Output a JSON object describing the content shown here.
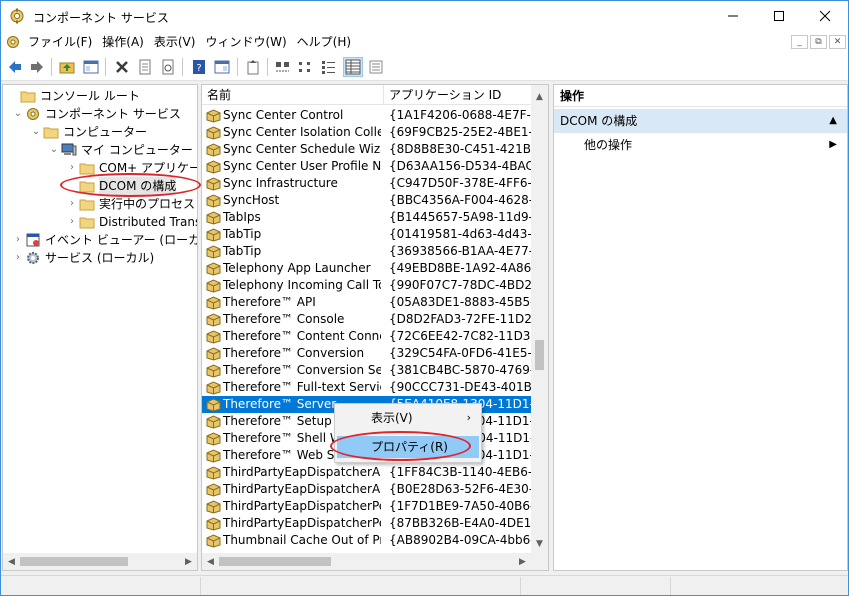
{
  "window": {
    "title": "コンポーネント サービス",
    "controls": {
      "minimize": "—",
      "maximize": "☐",
      "close": "✕"
    }
  },
  "menubar": {
    "items": [
      "ファイル(F)",
      "操作(A)",
      "表示(V)",
      "ウィンドウ(W)",
      "ヘルプ(H)"
    ],
    "mdi_minimize": "_",
    "mdi_restore": "⧉",
    "mdi_close": "✕"
  },
  "toolbar": {
    "icons": [
      "back-icon",
      "forward-icon",
      "up-folder-icon",
      "show-tree-icon",
      "delete-icon",
      "properties-icon",
      "refresh-icon",
      "help-icon",
      "action-pane-icon",
      "export-icon",
      "large-icons-icon",
      "small-icons-icon",
      "list-view-icon",
      "detail-view-icon",
      "tile-icon"
    ]
  },
  "tree": {
    "items": [
      {
        "label": "コンソール ルート",
        "expander": "",
        "icon": "folder-icon",
        "depth": 0
      },
      {
        "label": "コンポーネント サービス",
        "expander": "v",
        "icon": "component-services-icon",
        "depth": 1
      },
      {
        "label": "コンピューター",
        "expander": "v",
        "icon": "folder-icon",
        "depth": 2
      },
      {
        "label": "マイ コンピューター",
        "expander": "v",
        "icon": "computer-icon",
        "depth": 3
      },
      {
        "label": "COM+ アプリケーシ",
        "expander": ">",
        "icon": "folder-icon",
        "depth": 4
      },
      {
        "label": "DCOM の構成",
        "expander": "",
        "icon": "folder-icon",
        "depth": 4
      },
      {
        "label": "実行中のプロセス",
        "expander": ">",
        "icon": "folder-icon",
        "depth": 4
      },
      {
        "label": "Distributed Transa",
        "expander": ">",
        "icon": "folder-icon",
        "depth": 4
      },
      {
        "label": "イベント ビューアー (ローカル)",
        "expander": ">",
        "icon": "event-viewer-icon",
        "depth": 1
      },
      {
        "label": "サービス (ローカル)",
        "expander": ">",
        "icon": "services-gear-icon",
        "depth": 1
      }
    ],
    "selected_index": 5
  },
  "list": {
    "columns": [
      "名前",
      "アプリケーション ID"
    ],
    "rows": [
      {
        "name": "Sync Center Control",
        "id": "{1A1F4206-0688-4E7F-BE03"
      },
      {
        "name": "Sync Center Isolation Collect...",
        "id": "{69F9CB25-25E2-4BE1-AB8I"
      },
      {
        "name": "Sync Center Schedule Wizard",
        "id": "{8D8B8E30-C451-421B-855:"
      },
      {
        "name": "Sync Center User Profile Not...",
        "id": "{D63AA156-D534-4BAC-9B"
      },
      {
        "name": "Sync Infrastructure",
        "id": "{C947D50F-378E-4FF6-8835"
      },
      {
        "name": "SyncHost",
        "id": "{BBC4356A-F004-4628-A27."
      },
      {
        "name": "TabIps",
        "id": "{B1445657-5A98-11d9-A4E5"
      },
      {
        "name": "TabTip",
        "id": "{01419581-4d63-4d43-ac26"
      },
      {
        "name": "TabTip",
        "id": "{36938566-B1AA-4E77-9B3("
      },
      {
        "name": "Telephony App Launcher",
        "id": "{49EBD8BE-1A92-4A86-A65"
      },
      {
        "name": "Telephony Incoming Call To...",
        "id": "{990F07C7-78DC-4BD2-B14"
      },
      {
        "name": "Therefore™ API",
        "id": "{05A83DE1-8883-45B5-96B("
      },
      {
        "name": "Therefore™ Console",
        "id": "{D8D2FAD3-72FE-11D2-AD"
      },
      {
        "name": "Therefore™ Content Connec...",
        "id": "{72C6EE42-7C82-11D3-8E68"
      },
      {
        "name": "Therefore™ Conversion",
        "id": "{329C54FA-0FD6-41E5-9B18"
      },
      {
        "name": "Therefore™ Conversion Servi...",
        "id": "{381CB4BC-5870-4769-A89I"
      },
      {
        "name": "Therefore™ Full-text Service",
        "id": "{90CCC731-DE43-401B-A18"
      },
      {
        "name": "Therefore™ Server",
        "id": "{5EA410E8-1304-11D1-96E3"
      },
      {
        "name": "Therefore™ Setup Init",
        "id": "{5EA410E8-1304-11D1-96E3"
      },
      {
        "name": "Therefore™ Shell Wat",
        "id": "{F3BA5E2B-1304-11D1-96E3"
      },
      {
        "name": "Therefore™ Web Serv",
        "id": "{5EA410E8-1304-11D1-96E3"
      },
      {
        "name": "ThirdPartyEapDispatcherAut...",
        "id": "{1FF84C3B-1140-4EB6-BE38"
      },
      {
        "name": "ThirdPartyEapDispatcherAut...",
        "id": "{B0E28D63-52F6-4E30-992B"
      },
      {
        "name": "ThirdPartyEapDispatcherPee...",
        "id": "{1F7D1BE9-7A50-40B6-A60"
      },
      {
        "name": "ThirdPartyEapDispatcherPee...",
        "id": "{87BB326B-E4A0-4DE1-94F("
      },
      {
        "name": "Thumbnail Cache Out of Pro...",
        "id": "{AB8902B4-09CA-4bb6-B78"
      }
    ],
    "selected_index": 17
  },
  "context_menu": {
    "items": [
      {
        "label": "表示(V)",
        "submenu": "›"
      },
      {
        "label": "プロパティ(R)",
        "submenu": ""
      }
    ],
    "highlighted_index": 1
  },
  "actions": {
    "header": "操作",
    "section": "DCOM の構成",
    "section_toggle": "▲",
    "item": "他の操作",
    "item_arrow": "▶"
  },
  "colors": {
    "selection": "#0078d7",
    "annotation": "#e0242b",
    "context_highlight": "#91c9f7"
  }
}
